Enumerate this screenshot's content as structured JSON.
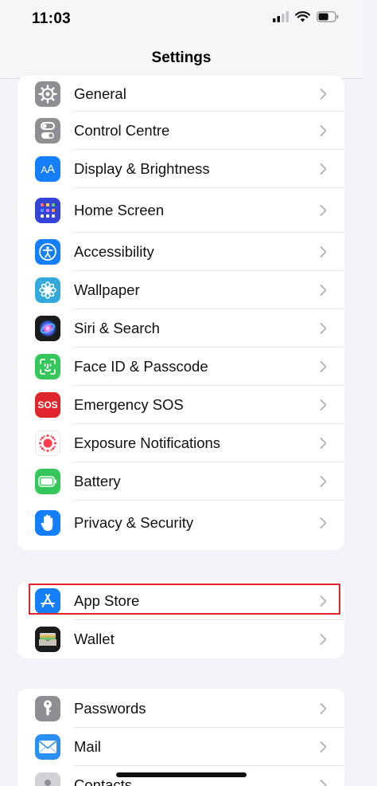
{
  "status_bar": {
    "time": "11:03",
    "icons": [
      "signal-icon",
      "wifi-icon",
      "battery-icon"
    ]
  },
  "nav": {
    "title": "Settings"
  },
  "groups": [
    {
      "items": [
        {
          "label": "General",
          "icon": "gear-icon",
          "icon_color": "#8e8e93"
        },
        {
          "label": "Control Centre",
          "icon": "toggles-icon",
          "icon_color": "#8e8e93"
        },
        {
          "label": "Display & Brightness",
          "icon": "text-size-icon",
          "icon_color": "#147efb"
        },
        {
          "label": "Home Screen",
          "icon": "app-grid-icon",
          "icon_color": "#3444d6"
        },
        {
          "label": "Accessibility",
          "icon": "accessibility-icon",
          "icon_color": "#147efb"
        },
        {
          "label": "Wallpaper",
          "icon": "flower-icon",
          "icon_color": "#34aadc"
        },
        {
          "label": "Siri & Search",
          "icon": "siri-icon",
          "icon_color": "#1c1c1e"
        },
        {
          "label": "Face ID & Passcode",
          "icon": "face-id-icon",
          "icon_color": "#34c759"
        },
        {
          "label": "Emergency SOS",
          "icon": "sos-icon",
          "icon_color": "#e0262c",
          "icon_text": "SOS"
        },
        {
          "label": "Exposure Notifications",
          "icon": "exposure-icon",
          "icon_color": "#ffffff"
        },
        {
          "label": "Battery",
          "icon": "battery-settings-icon",
          "icon_color": "#34c759"
        },
        {
          "label": "Privacy & Security",
          "icon": "hand-icon",
          "icon_color": "#147efb"
        }
      ]
    },
    {
      "items": [
        {
          "label": "App Store",
          "icon": "app-store-icon",
          "icon_color": "#147efb"
        },
        {
          "label": "Wallet",
          "icon": "wallet-icon",
          "icon_color": "#1c1c1e"
        }
      ]
    },
    {
      "items": [
        {
          "label": "Passwords",
          "icon": "key-icon",
          "icon_color": "#8e8e93"
        },
        {
          "label": "Mail",
          "icon": "mail-icon",
          "icon_color": "#2a8ff7"
        },
        {
          "label": "Contacts",
          "icon": "contacts-icon",
          "icon_color": "#c7c7cc"
        }
      ]
    }
  ],
  "colors": {
    "background": "#f2f2f7",
    "highlight_border": "#e0262c",
    "chevron": "#b8b8bd"
  }
}
